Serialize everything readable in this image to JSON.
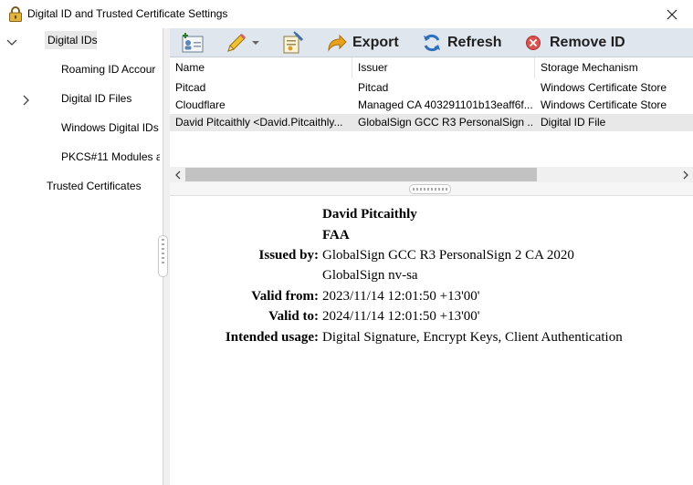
{
  "window": {
    "title": "Digital ID and Trusted Certificate Settings",
    "icons": {
      "title": "lock-icon",
      "close": "close-icon"
    }
  },
  "tree": {
    "items": [
      {
        "label": "Digital IDs",
        "level": 0,
        "expanded": true,
        "selected": true
      },
      {
        "label": "Roaming ID Accour",
        "level": 1
      },
      {
        "label": "Digital ID Files",
        "level": 1,
        "has_children": true
      },
      {
        "label": "Windows Digital IDs",
        "level": 1
      },
      {
        "label": "PKCS#11 Modules a",
        "level": 1
      },
      {
        "label": "Trusted Certificates",
        "level": 0
      }
    ]
  },
  "toolbar": {
    "add_id_icon": "add-id-icon",
    "edit_icon": "pencil-icon",
    "certificate_details_icon": "certificate-details-icon",
    "export_label": "Export",
    "refresh_label": "Refresh",
    "remove_label": "Remove ID"
  },
  "table": {
    "columns": [
      "Name",
      "Issuer",
      "Storage Mechanism"
    ],
    "rows": [
      {
        "name": "Pitcad",
        "issuer": "Pitcad",
        "storage": "Windows Certificate Store"
      },
      {
        "name": "Cloudflare",
        "issuer": "Managed CA 403291101b13eaff6f...",
        "storage": "Windows Certificate Store"
      },
      {
        "name": "David Pitcaithly <David.Pitcaithly...",
        "issuer": "GlobalSign GCC R3 PersonalSign ...",
        "storage": "Digital ID File",
        "selected": true
      }
    ]
  },
  "details": {
    "name": "David Pitcaithly",
    "org": "FAA",
    "issued_by_label": "Issued by:",
    "issued_by": "GlobalSign GCC R3 PersonalSign 2 CA 2020",
    "issued_by_org": "GlobalSign nv-sa",
    "valid_from_label": "Valid from:",
    "valid_from": "2023/11/14 12:01:50 +13'00'",
    "valid_to_label": "Valid to:",
    "valid_to": "2024/11/14 12:01:50 +13'00'",
    "usage_label": "Intended usage:",
    "usage": "Digital Signature, Encrypt Keys, Client Authentication"
  },
  "colors": {
    "toolbar_bg": "#dfe6ee",
    "selection": "#e8e8e8",
    "export_arrow": "#e8a21c",
    "refresh_blue": "#2f6fbe",
    "remove_red": "#d9534f"
  }
}
